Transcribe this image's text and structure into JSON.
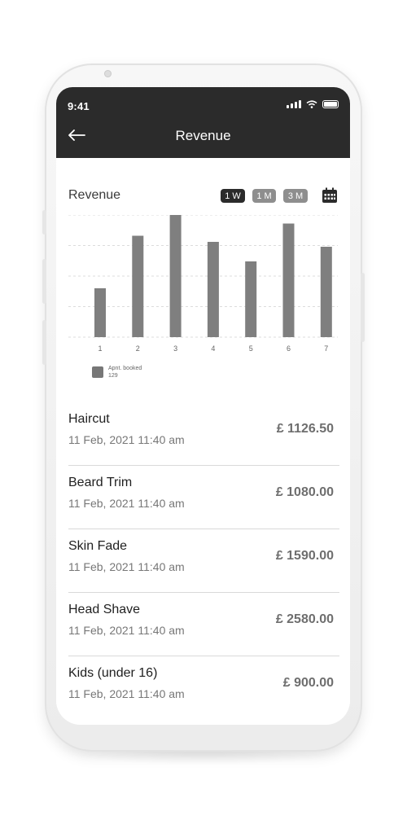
{
  "status_bar": {
    "time": "9:41"
  },
  "app_bar": {
    "title": "Revenue",
    "back_icon": "arrow-left-icon"
  },
  "section_title": "Revenue",
  "range_options": [
    {
      "label": "1 W",
      "selected": true
    },
    {
      "label": "1 M",
      "selected": false
    },
    {
      "label": "3 M",
      "selected": false
    }
  ],
  "calendar_icon": "calendar-icon",
  "chart_data": {
    "type": "bar",
    "categories": [
      "1",
      "2",
      "3",
      "4",
      "5",
      "6",
      "7"
    ],
    "values": [
      40,
      83,
      100,
      78,
      62,
      93,
      74
    ],
    "ylim": [
      0,
      100
    ],
    "grid": true,
    "legend_label": "Apnt. booked",
    "legend_value": "129",
    "bar_color": "#7f7f7f"
  },
  "transactions": [
    {
      "name": "Haircut",
      "date": "11 Feb, 2021  11:40 am",
      "amount": "£ 1126.50"
    },
    {
      "name": "Beard Trim",
      "date": "11 Feb, 2021  11:40 am",
      "amount": "£ 1080.00"
    },
    {
      "name": "Skin Fade",
      "date": "11 Feb, 2021  11:40 am",
      "amount": "£ 1590.00"
    },
    {
      "name": "Head Shave",
      "date": "11 Feb, 2021  11:40 am",
      "amount": "£ 2580.00"
    },
    {
      "name": "Kids (under 16)",
      "date": "11 Feb, 2021  11:40 am",
      "amount": "£ 900.00"
    }
  ],
  "colors": {
    "appbar": "#2b2b2b",
    "selected_chip": "#2b2b2b",
    "chip": "#8e8e8e"
  }
}
